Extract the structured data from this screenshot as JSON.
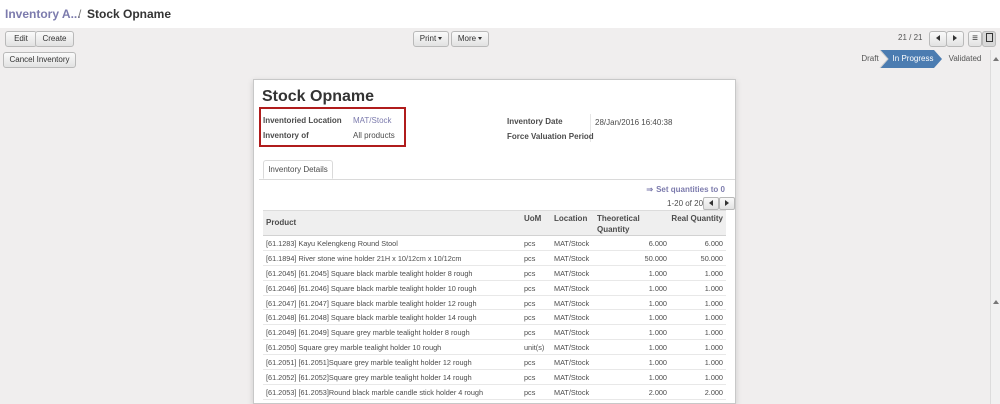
{
  "breadcrumb": {
    "parent": "Inventory A...",
    "separator": "/",
    "current": "Stock Opname"
  },
  "toolbar": {
    "edit_label": "Edit",
    "create_label": "Create",
    "print_label": "Print",
    "more_label": "More"
  },
  "pager": {
    "text": "21 / 21"
  },
  "status": {
    "cancel_label": "Cancel Inventory",
    "stages": [
      "Draft",
      "In Progress",
      "Validated"
    ],
    "active_stage": "In Progress"
  },
  "colors": {
    "accent": "#7c7bad",
    "active_stage": "#4b7cb1",
    "highlight_box": "#b01c1c"
  },
  "form": {
    "title": "Stock Opname",
    "location_label": "Inventoried Location",
    "location_value": "MAT/Stock",
    "inventory_of_label": "Inventory of",
    "inventory_of_value": "All products",
    "date_label": "Inventory Date",
    "date_value": "28/Jan/2016 16:40:38",
    "force_label": "Force Valuation Period"
  },
  "tabs": [
    {
      "label": "Inventory Details"
    }
  ],
  "lines": {
    "set_quantities_label": "Set quantities to 0",
    "pager_text": "1-20 of 2026",
    "columns": [
      "Product",
      "UoM",
      "Location",
      "Theoretical Quantity",
      "Real Quantity"
    ],
    "rows": [
      [
        "[61.1283] Kayu Kelengkeng Round Stool",
        "pcs",
        "MAT/Stock",
        "6.000",
        "6.000"
      ],
      [
        "[61.1894] River stone wine holder 21H x 10/12cm x 10/12cm",
        "pcs",
        "MAT/Stock",
        "50.000",
        "50.000"
      ],
      [
        "[61.2045] [61.2045] Square black marble tealight holder 8 rough",
        "pcs",
        "MAT/Stock",
        "1.000",
        "1.000"
      ],
      [
        "[61.2046] [61.2046] Square black marble tealight holder 10 rough",
        "pcs",
        "MAT/Stock",
        "1.000",
        "1.000"
      ],
      [
        "[61.2047] [61.2047] Square black marble tealight holder 12 rough",
        "pcs",
        "MAT/Stock",
        "1.000",
        "1.000"
      ],
      [
        "[61.2048] [61.2048] Square black marble tealight holder 14 rough",
        "pcs",
        "MAT/Stock",
        "1.000",
        "1.000"
      ],
      [
        "[61.2049] [61.2049] Square grey marble tealight holder 8 rough",
        "pcs",
        "MAT/Stock",
        "1.000",
        "1.000"
      ],
      [
        "[61.2050] Square grey marble tealight holder 10 rough",
        "unit(s)",
        "MAT/Stock",
        "1.000",
        "1.000"
      ],
      [
        "[61.2051] [61.2051]Square grey marble tealight holder 12 rough",
        "pcs",
        "MAT/Stock",
        "1.000",
        "1.000"
      ],
      [
        "[61.2052] [61.2052]Square grey marble tealight holder 14 rough",
        "pcs",
        "MAT/Stock",
        "1.000",
        "1.000"
      ],
      [
        "[61.2053] [61.2053]Round black marble candle stick holder 4 rough",
        "pcs",
        "MAT/Stock",
        "2.000",
        "2.000"
      ]
    ]
  }
}
